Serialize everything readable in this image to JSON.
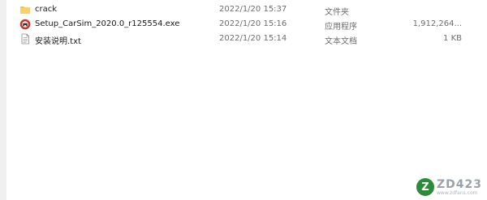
{
  "files": [
    {
      "name": "crack",
      "modified": "2022/1/20 15:37",
      "type": "文件夹",
      "size": "",
      "icon": "folder-icon",
      "icon_color": "#f2c14e"
    },
    {
      "name": "Setup_CarSim_2020.0_r125554.exe",
      "modified": "2022/1/20 15:16",
      "type": "应用程序",
      "size": "1,912,264...",
      "icon": "carsim-app-icon",
      "icon_color": "#c0392b"
    },
    {
      "name": "安装说明.txt",
      "modified": "2022/1/20 15:14",
      "type": "文本文档",
      "size": "1 KB",
      "icon": "text-file-icon",
      "icon_color": "#7a7a7a"
    }
  ],
  "watermark": {
    "badge": "Z",
    "main": "ZD423",
    "sub": "www.zdfans.com",
    "color": "#2e8b3a"
  }
}
